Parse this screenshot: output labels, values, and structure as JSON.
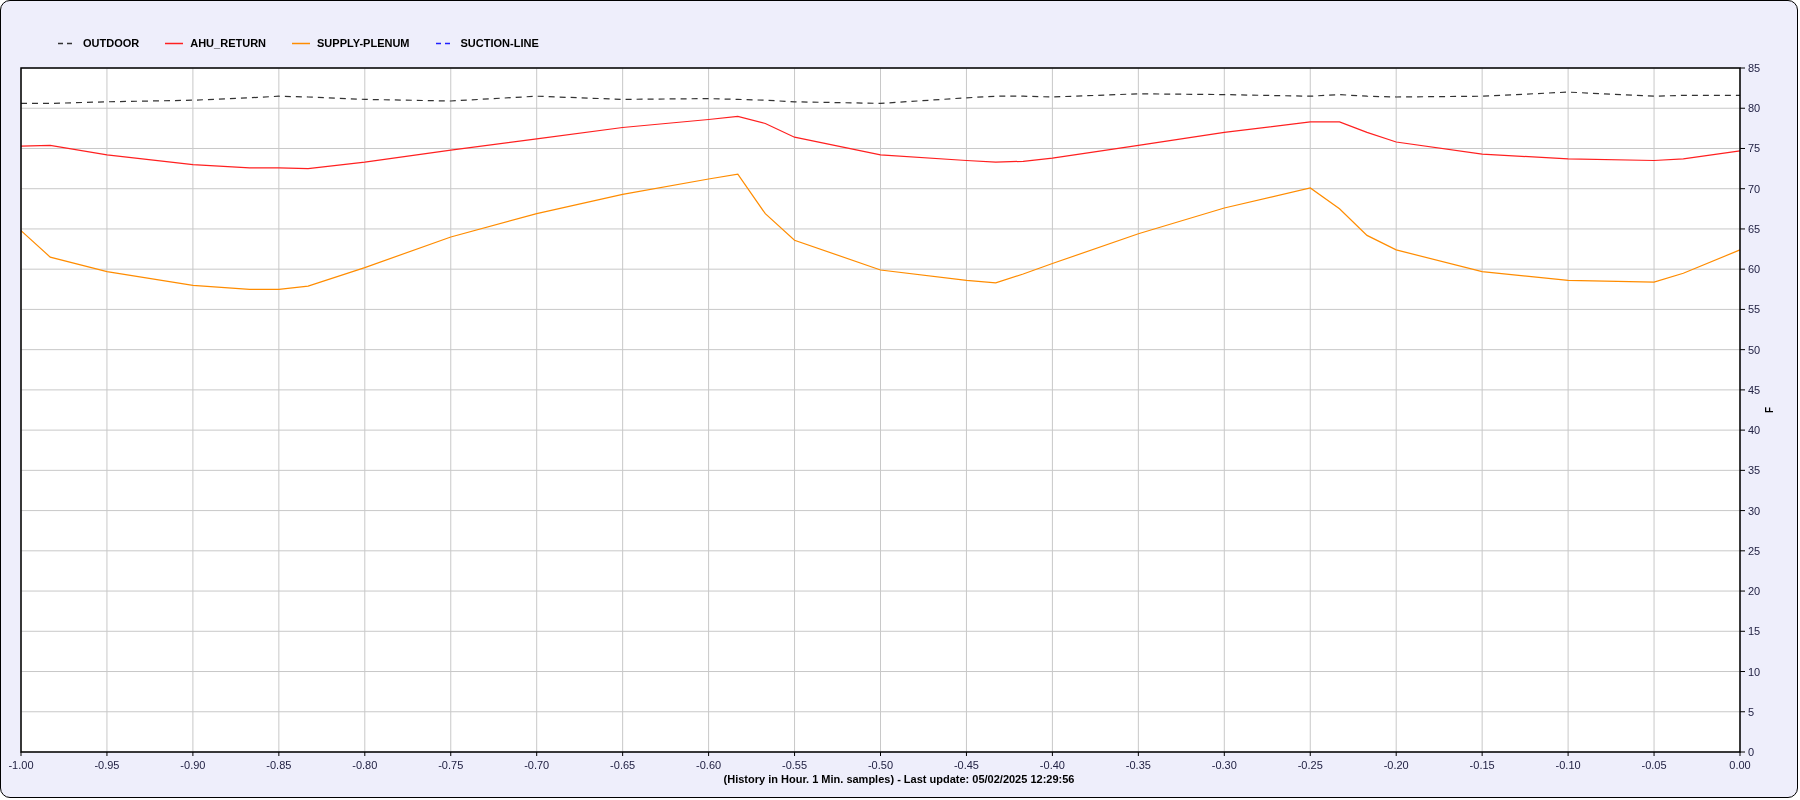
{
  "chart_data": {
    "type": "line",
    "xlabel": "(History in Hour. 1 Min. samples) - Last update: 05/02/2025 12:29:56",
    "ylabel": "F",
    "x": [
      -1.0,
      -0.983,
      -0.95,
      -0.9,
      -0.867,
      -0.85,
      -0.833,
      -0.8,
      -0.75,
      -0.7,
      -0.65,
      -0.6,
      -0.583,
      -0.567,
      -0.55,
      -0.5,
      -0.45,
      -0.433,
      -0.417,
      -0.4,
      -0.35,
      -0.3,
      -0.25,
      -0.233,
      -0.217,
      -0.2,
      -0.15,
      -0.1,
      -0.05,
      -0.033,
      0.0
    ],
    "series": [
      {
        "name": "OUTDOOR",
        "color": "#333333",
        "line_style": "dashed",
        "values": [
          80.6,
          80.6,
          80.8,
          81.0,
          81.3,
          81.5,
          81.4,
          81.1,
          80.9,
          81.5,
          81.1,
          81.2,
          81.1,
          81.0,
          80.8,
          80.6,
          81.3,
          81.5,
          81.5,
          81.4,
          81.8,
          81.7,
          81.5,
          81.7,
          81.5,
          81.4,
          81.5,
          82.0,
          81.5,
          81.6,
          81.6
        ]
      },
      {
        "name": "AHU_RETURN",
        "color": "#ff2020",
        "line_style": "solid",
        "values": [
          75.3,
          75.4,
          74.2,
          73.0,
          72.6,
          72.6,
          72.5,
          73.3,
          74.8,
          76.2,
          77.6,
          78.6,
          79.0,
          78.1,
          76.4,
          74.2,
          73.5,
          73.3,
          73.4,
          73.8,
          75.4,
          77.0,
          78.3,
          78.3,
          77.0,
          75.8,
          74.3,
          73.7,
          73.5,
          73.7,
          74.7
        ]
      },
      {
        "name": "SUPPLY-PLENUM",
        "color": "#ff8c00",
        "line_style": "solid",
        "values": [
          64.8,
          61.5,
          59.7,
          58.0,
          57.5,
          57.5,
          57.9,
          60.2,
          64.0,
          66.9,
          69.3,
          71.2,
          71.8,
          66.9,
          63.6,
          59.9,
          58.6,
          58.3,
          59.4,
          60.7,
          64.4,
          67.6,
          70.1,
          67.5,
          64.2,
          62.4,
          59.7,
          58.6,
          58.4,
          59.5,
          62.4
        ]
      },
      {
        "name": "SUCTION-LINE",
        "color": "#2020ff",
        "line_style": "dashed",
        "values": [
          null,
          null,
          null,
          null,
          null,
          null,
          null,
          null,
          null,
          null,
          null,
          null,
          null,
          null,
          null,
          null,
          null,
          null,
          null,
          null,
          null,
          null,
          null,
          null,
          null,
          null,
          null,
          null,
          null,
          null,
          null
        ]
      }
    ],
    "grid": true,
    "xlim": [
      -1,
      0
    ],
    "ylim": [
      0,
      85
    ],
    "xticks": [
      {
        "value": -1,
        "label": "-1.00"
      },
      {
        "value": -0.95,
        "label": "-0.95"
      },
      {
        "value": -0.9,
        "label": "-0.90"
      },
      {
        "value": -0.85,
        "label": "-0.85"
      },
      {
        "value": -0.8,
        "label": "-0.80"
      },
      {
        "value": -0.75,
        "label": "-0.75"
      },
      {
        "value": -0.7,
        "label": "-0.70"
      },
      {
        "value": -0.65,
        "label": "-0.65"
      },
      {
        "value": -0.6,
        "label": "-0.60"
      },
      {
        "value": -0.55,
        "label": "-0.55"
      },
      {
        "value": -0.5,
        "label": "-0.50"
      },
      {
        "value": -0.45,
        "label": "-0.45"
      },
      {
        "value": -0.4,
        "label": "-0.40"
      },
      {
        "value": -0.35,
        "label": "-0.35"
      },
      {
        "value": -0.3,
        "label": "-0.30"
      },
      {
        "value": -0.25,
        "label": "-0.25"
      },
      {
        "value": -0.2,
        "label": "-0.20"
      },
      {
        "value": -0.15,
        "label": "-0.15"
      },
      {
        "value": -0.1,
        "label": "-0.10"
      },
      {
        "value": -0.05,
        "label": "-0.05"
      },
      {
        "value": 0,
        "label": "0.00"
      }
    ],
    "yticks": [
      0,
      5,
      10,
      15,
      20,
      25,
      30,
      35,
      40,
      45,
      50,
      55,
      60,
      65,
      70,
      75,
      80,
      85
    ]
  }
}
